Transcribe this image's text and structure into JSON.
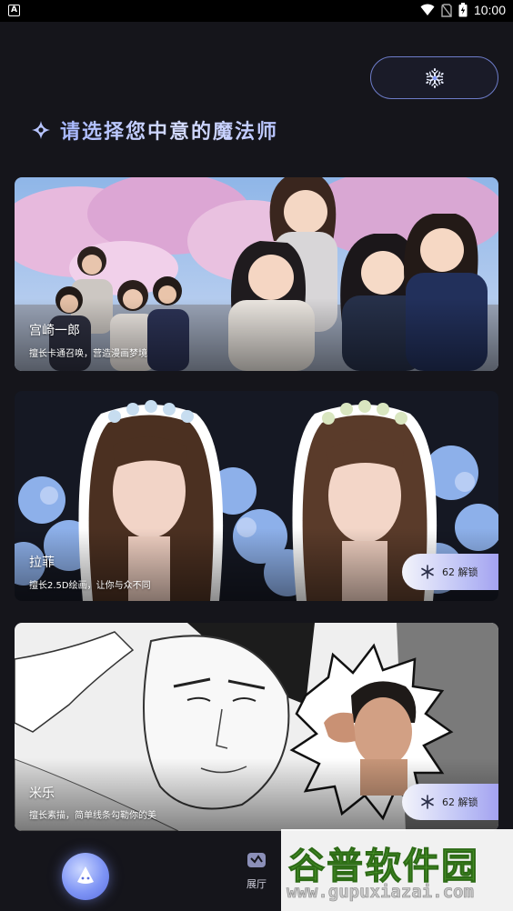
{
  "status_bar": {
    "badge": "A",
    "time": "10:00"
  },
  "header": {
    "energy_icon": "snowflake-icon",
    "title": "请选择您中意的魔法师"
  },
  "cards": [
    {
      "name": "宫崎一郎",
      "description": "擅长卡通召唤，营造漫画梦境",
      "unlock": null
    },
    {
      "name": "拉菲",
      "description": "擅长2.5D绘画，让你与众不同",
      "unlock": "62 解锁"
    },
    {
      "name": "米乐",
      "description": "擅长素描，简单线条勾勒你的美",
      "unlock": "62 解锁"
    }
  ],
  "nav": {
    "home_icon": "wizard-hat-icon",
    "gallery_label": "展厅"
  },
  "watermark": {
    "big": "谷普软件园",
    "small": "www.gupuxiazai.com"
  },
  "colors": {
    "background": "#15151b",
    "accent": "#8fa2ff",
    "unlock_gradient_end": "#a4a2f0"
  }
}
